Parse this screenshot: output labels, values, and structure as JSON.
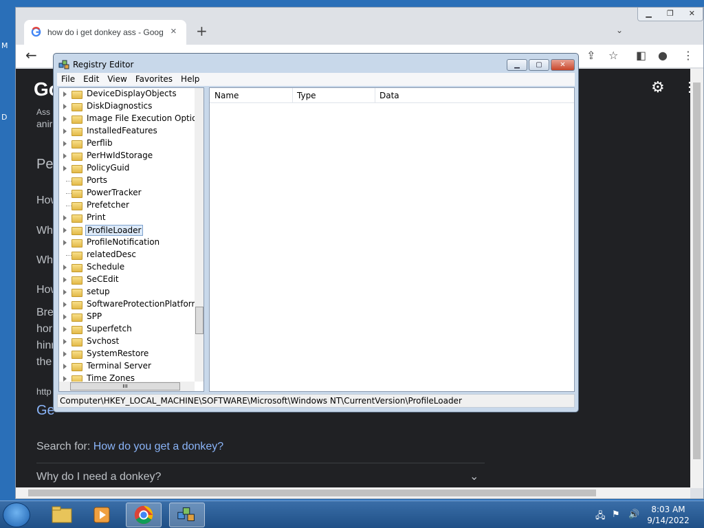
{
  "desktop": {
    "edge_labels": [
      "M",
      "D"
    ]
  },
  "browser": {
    "tab_title": "how do i get donkey ass - Google",
    "page": {
      "logo": "Go",
      "snippet_a": "Ass",
      "snippet_b": "anir",
      "heading": "Pe",
      "lines": [
        "How",
        "Wh",
        "Wh",
        "How"
      ],
      "para": [
        "Bre",
        "hor",
        "hinr",
        "the"
      ],
      "url_frag": "http",
      "link_frag": "Ge",
      "search_for_label": "Search for:",
      "search_for_link": "How do you get a donkey?",
      "question": "Why do I need a donkey?"
    }
  },
  "regedit": {
    "title": "Registry Editor",
    "menu": [
      "File",
      "Edit",
      "View",
      "Favorites",
      "Help"
    ],
    "tree_items": [
      {
        "label": "DeviceDisplayObjects",
        "expandable": true
      },
      {
        "label": "DiskDiagnostics",
        "expandable": true
      },
      {
        "label": "Image File Execution Options",
        "expandable": true
      },
      {
        "label": "InstalledFeatures",
        "expandable": true
      },
      {
        "label": "Perflib",
        "expandable": true
      },
      {
        "label": "PerHwIdStorage",
        "expandable": true
      },
      {
        "label": "PolicyGuid",
        "expandable": true
      },
      {
        "label": "Ports",
        "expandable": false
      },
      {
        "label": "PowerTracker",
        "expandable": false
      },
      {
        "label": "Prefetcher",
        "expandable": false
      },
      {
        "label": "Print",
        "expandable": true
      },
      {
        "label": "ProfileLoader",
        "expandable": true,
        "selected": true
      },
      {
        "label": "ProfileNotification",
        "expandable": true
      },
      {
        "label": "relatedDesc",
        "expandable": false
      },
      {
        "label": "Schedule",
        "expandable": true
      },
      {
        "label": "SeCEdit",
        "expandable": true
      },
      {
        "label": "setup",
        "expandable": true
      },
      {
        "label": "SoftwareProtectionPlatform",
        "expandable": true
      },
      {
        "label": "SPP",
        "expandable": true
      },
      {
        "label": "Superfetch",
        "expandable": true
      },
      {
        "label": "Svchost",
        "expandable": true
      },
      {
        "label": "SystemRestore",
        "expandable": true
      },
      {
        "label": "Terminal Server",
        "expandable": true
      },
      {
        "label": "Time Zones",
        "expandable": true
      }
    ],
    "columns": [
      "Name",
      "Type",
      "Data"
    ],
    "status_path": "Computer\\HKEY_LOCAL_MACHINE\\SOFTWARE\\Microsoft\\Windows NT\\CurrentVersion\\ProfileLoader"
  },
  "taskbar": {
    "time": "8:03 AM",
    "date": "9/14/2022"
  },
  "colors": {
    "accent_link": "#8ab4f8",
    "page_bg": "#202124"
  }
}
